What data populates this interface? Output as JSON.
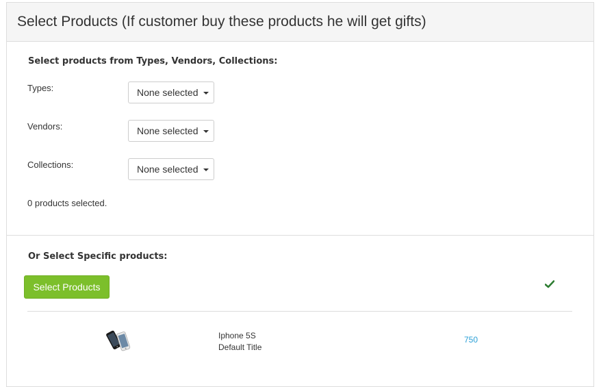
{
  "header": {
    "title": "Select Products (If customer buy these products he will get gifts)"
  },
  "filter_section": {
    "heading": "Select products from Types, Vendors, Collections:",
    "fields": [
      {
        "label": "Types:",
        "value": "None selected"
      },
      {
        "label": "Vendors:",
        "value": "None selected"
      },
      {
        "label": "Collections:",
        "value": "None selected"
      }
    ],
    "count_text": "0 products selected."
  },
  "specific_section": {
    "heading": "Or Select Specific products:",
    "button_label": "Select Products",
    "check_color": "#2e7d32"
  },
  "products": [
    {
      "name": "Iphone 5S",
      "variant": "Default Title",
      "price": "750"
    }
  ],
  "colors": {
    "accent_green": "#7cbf2b",
    "link_blue": "#2a9fd6"
  }
}
